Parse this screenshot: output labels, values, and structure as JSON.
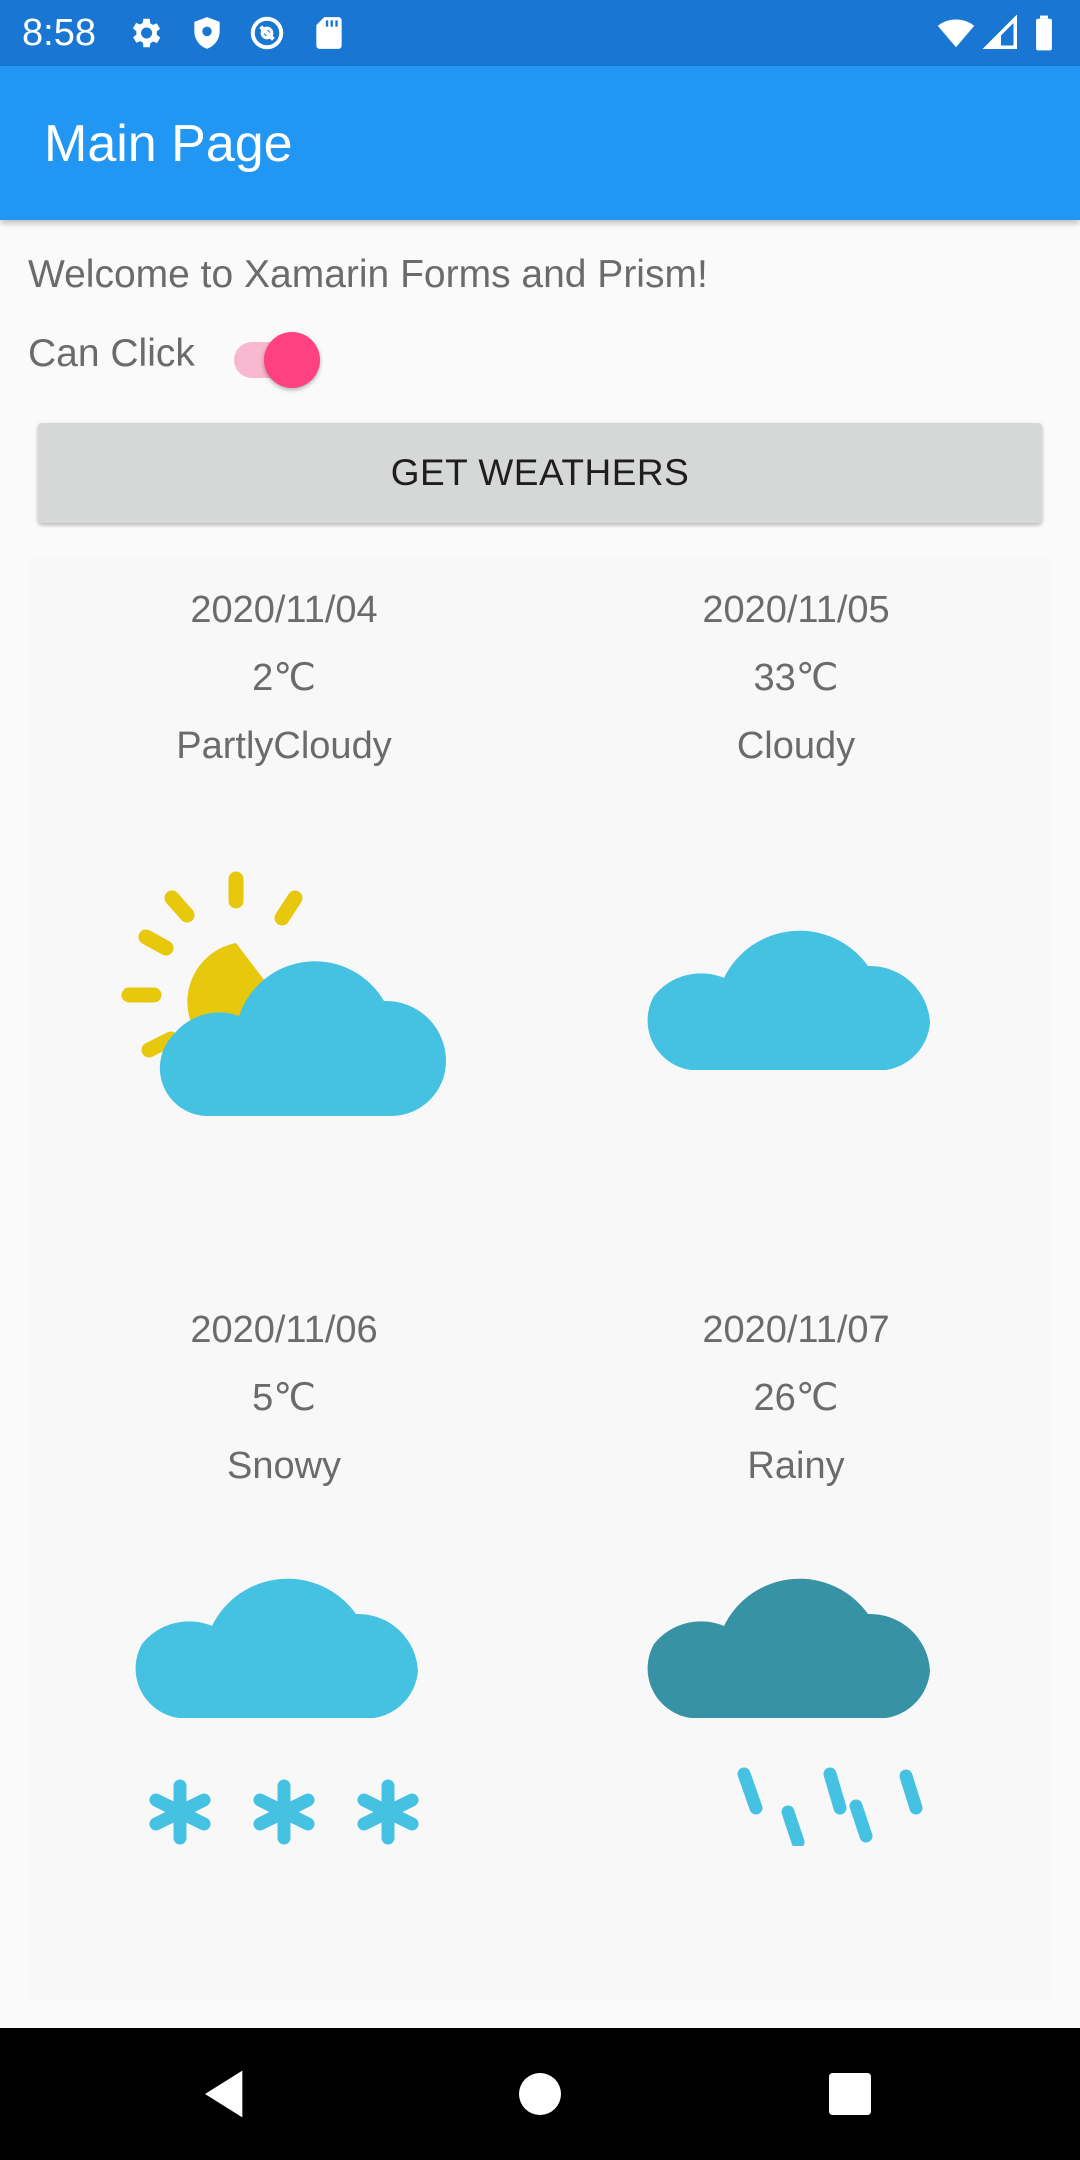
{
  "status_bar": {
    "time": "8:58",
    "left_icons": [
      "gear-icon",
      "shield-icon",
      "at-sign-icon",
      "sd-card-icon"
    ],
    "right_icons": [
      "wifi-icon",
      "cell-signal-icon",
      "battery-icon"
    ]
  },
  "app_bar": {
    "title": "Main Page"
  },
  "welcome_text": "Welcome to Xamarin Forms and Prism!",
  "can_click": {
    "label": "Can Click",
    "on": true
  },
  "get_button": {
    "label": "GET WEATHERS"
  },
  "weathers": [
    {
      "date": "2020/11/04",
      "temp": "2℃",
      "condition": "PartlyCloudy",
      "icon": "partly-cloudy-icon"
    },
    {
      "date": "2020/11/05",
      "temp": "33℃",
      "condition": "Cloudy",
      "icon": "cloudy-icon"
    },
    {
      "date": "2020/11/06",
      "temp": "5℃",
      "condition": "Snowy",
      "icon": "snowy-icon"
    },
    {
      "date": "2020/11/07",
      "temp": "26℃",
      "condition": "Rainy",
      "icon": "rainy-icon"
    }
  ],
  "nav_bar": {
    "buttons": [
      "back-icon",
      "home-icon",
      "recents-icon"
    ]
  },
  "colors": {
    "status_bar": "#1976d2",
    "app_bar": "#2196f3",
    "accent": "#ff4081",
    "cloud": "#45c1e2",
    "rain_cloud": "#3792a6",
    "sun": "#e8c80c"
  }
}
